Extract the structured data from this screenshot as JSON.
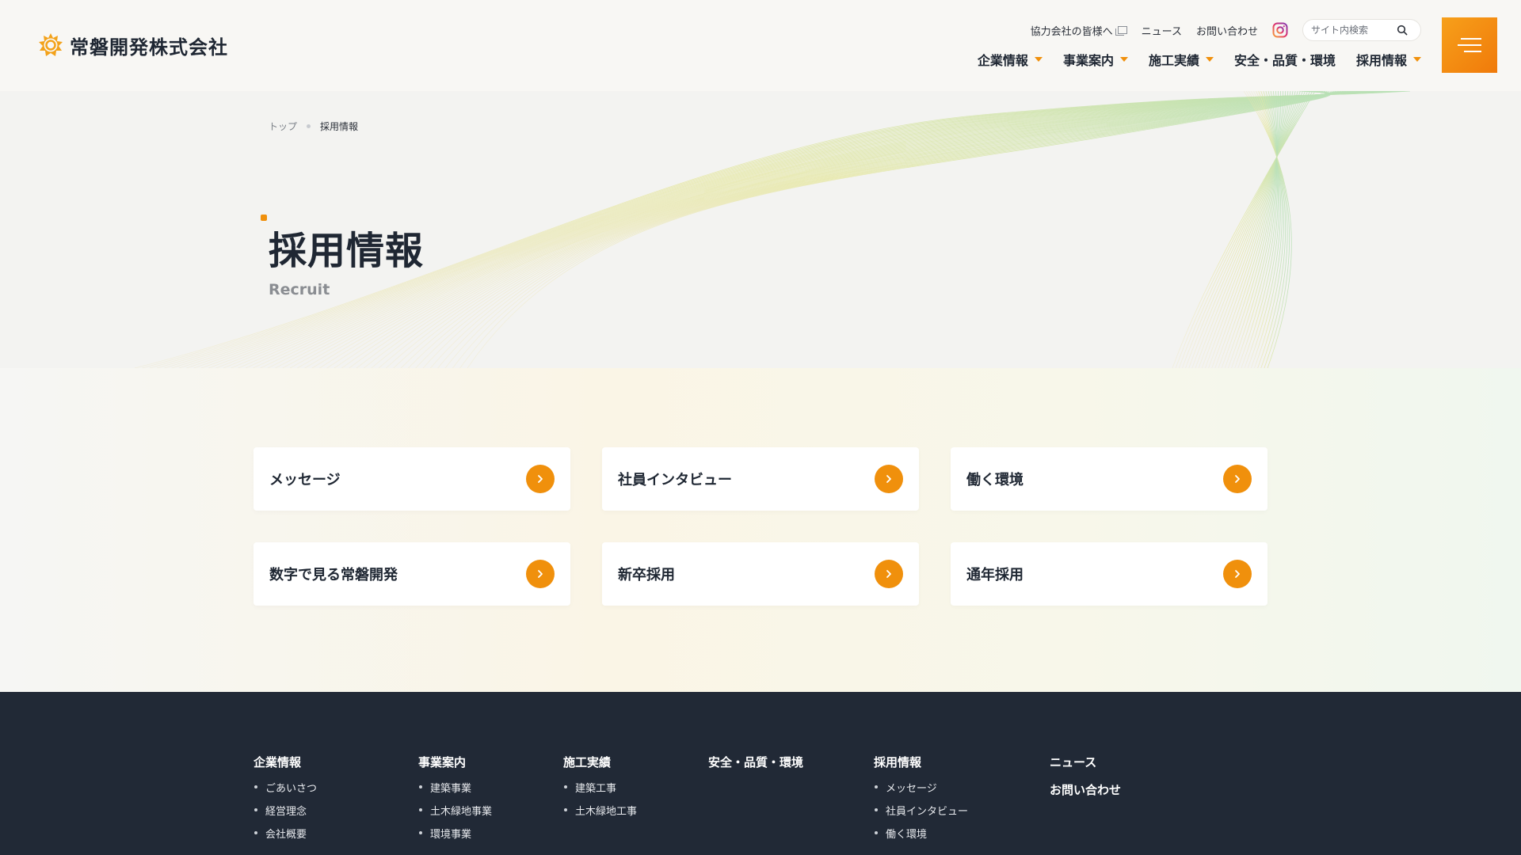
{
  "brand": {
    "name": "常磐開発株式会社",
    "accent_color": "#f0900c",
    "dark_color": "#212936"
  },
  "util_nav": {
    "partners": "協力会社の皆様へ",
    "news": "ニュース",
    "contact": "お問い合わせ",
    "instagram_icon": "instagram-icon",
    "search_placeholder": "サイト内検索"
  },
  "main_nav": [
    {
      "label": "企業情報",
      "has_dropdown": true
    },
    {
      "label": "事業案内",
      "has_dropdown": true
    },
    {
      "label": "施工実績",
      "has_dropdown": true
    },
    {
      "label": "安全・品質・環境",
      "has_dropdown": false
    },
    {
      "label": "採用情報",
      "has_dropdown": true
    }
  ],
  "breadcrumb": {
    "home": "トップ",
    "current": "採用情報"
  },
  "hero": {
    "title": "採用情報",
    "subtitle": "Recruit"
  },
  "cards": [
    {
      "label": "メッセージ"
    },
    {
      "label": "社員インタビュー"
    },
    {
      "label": "働く環境"
    },
    {
      "label": "数字で見る常磐開発"
    },
    {
      "label": "新卒採用"
    },
    {
      "label": "通年採用"
    }
  ],
  "footer": {
    "columns": [
      {
        "heading": "企業情報",
        "items": [
          "ごあいさつ",
          "経営理念",
          "会社概要"
        ]
      },
      {
        "heading": "事業案内",
        "items": [
          "建築事業",
          "土木緑地事業",
          "環境事業"
        ]
      },
      {
        "heading": "施工実績",
        "items": [
          "建築工事",
          "土木緑地工事"
        ]
      },
      {
        "heading": "安全・品質・環境",
        "items": []
      },
      {
        "heading": "採用情報",
        "items": [
          "メッセージ",
          "社員インタビュー",
          "働く環境"
        ]
      }
    ],
    "singles": [
      "ニュース",
      "お問い合わせ"
    ]
  }
}
